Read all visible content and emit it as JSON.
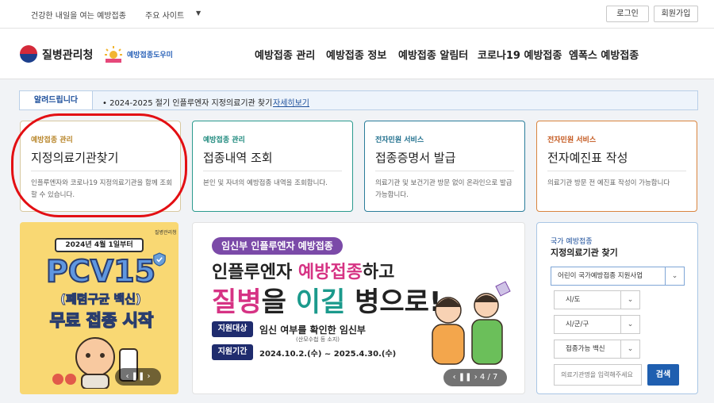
{
  "util_bar": {
    "slogan": "건강한 내일을 여는 예방접종",
    "sites_label": "주요 사이트",
    "login": "로그인",
    "join": "회원가입"
  },
  "header": {
    "logo": "질병관리청",
    "helper_logo": "예방접종도우미",
    "nav": [
      "예방접종 관리",
      "예방접종 정보",
      "예방접종 알림터",
      "코로나19 예방접종",
      "엠폭스 예방접종"
    ]
  },
  "notice": {
    "label": "알려드립니다",
    "text": "• 2024-2025 절기 인플루엔자 지정의료기관 찾기",
    "more": "자세히보기"
  },
  "cards": [
    {
      "category": "예방접종 관리",
      "title": "지정의료기관찾기",
      "desc": "인플루엔자와 코로나19 지정의료기관을 함께 조회할 수 있습니다."
    },
    {
      "category": "예방접종 관리",
      "title": "접종내역 조회",
      "desc": "본인 및 자녀의 예방접종 내역을 조회합니다."
    },
    {
      "category": "전자민원 서비스",
      "title": "접종증명서 발급",
      "desc": "의료기관 및 보건기관 방문 없이 온라인으로 발급가능합니다."
    },
    {
      "category": "전자민원 서비스",
      "title": "전자예진표 작성",
      "desc": "의료기관 방문 전 예진표 작성이 가능합니다"
    }
  ],
  "banner1": {
    "agency": "질병관리청",
    "date_tag": "2024년 4월 1일부터",
    "headline": "PCV15",
    "subline": "(폐렴구균 백신)",
    "cta": "무료 접종 시작",
    "controls": "‹  ❚❚  ›"
  },
  "banner2": {
    "tag": "임신부 인플루엔자 예방접종",
    "line1_a": "인플루엔자 ",
    "line1_b": "예방접종",
    "line1_c": "하고",
    "line2_a": "질병",
    "line2_b": "을 ",
    "line2_c": "이길",
    "line2_d": " 병으로!",
    "target_label": "지원대상",
    "target_text": "임신 여부를 확인한 임신부",
    "target_note": "(산모수첩 등 소지)",
    "period_label": "지원기간",
    "period_text": "2024.10.2.(수) ~ 2025.4.30.(수)",
    "pager": "‹  ❚❚  ›   4 / 7"
  },
  "search_box": {
    "sub": "국가 예방접종",
    "head": "지정의료기관 찾기",
    "program": "어린이 국가예방접종 지원사업",
    "sido": "시/도",
    "sigungu": "시/군/구",
    "vaccine": "접종가능 백신",
    "placeholder": "의료기관명을 입력해주세요",
    "submit": "검색"
  },
  "colors": {
    "accent": "#1f5fb0",
    "highlight": "#e30f13",
    "banner_pink": "#d63384",
    "banner_teal": "#1b9a8c"
  }
}
